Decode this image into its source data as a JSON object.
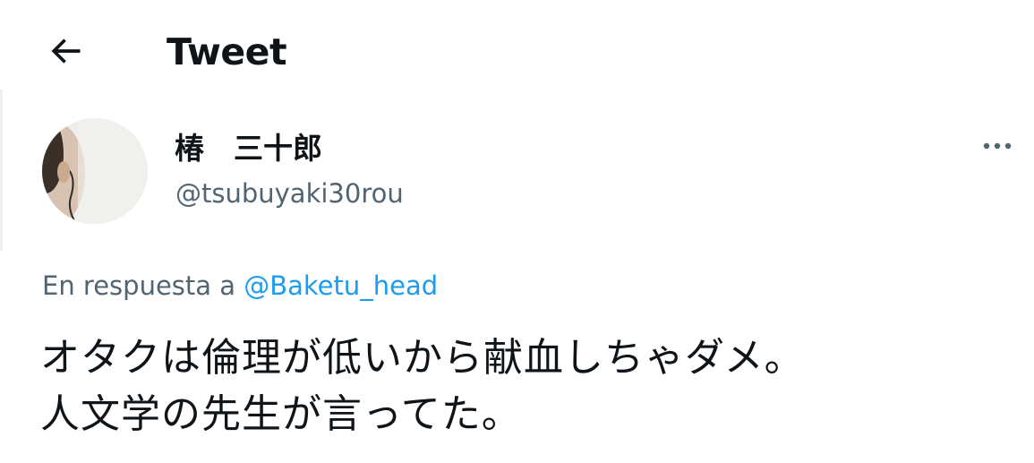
{
  "header": {
    "back_icon": "arrow-left-icon",
    "title": "Tweet"
  },
  "author": {
    "avatar_icon": "avatar",
    "display_name": "椿　三十郎",
    "handle": "@tsubuyaki30rou"
  },
  "more_icon": "ellipsis-icon",
  "reply_context": {
    "prefix": "En respuesta a ",
    "mention": "@Baketu_head"
  },
  "tweet": {
    "lines": [
      "オタクは倫理が低いから献血しちゃダメ。",
      "人文学の先生が言ってた。"
    ]
  },
  "colors": {
    "text_primary": "#0f1419",
    "text_secondary": "#536471",
    "link": "#1d9bf0",
    "background": "#ffffff"
  }
}
